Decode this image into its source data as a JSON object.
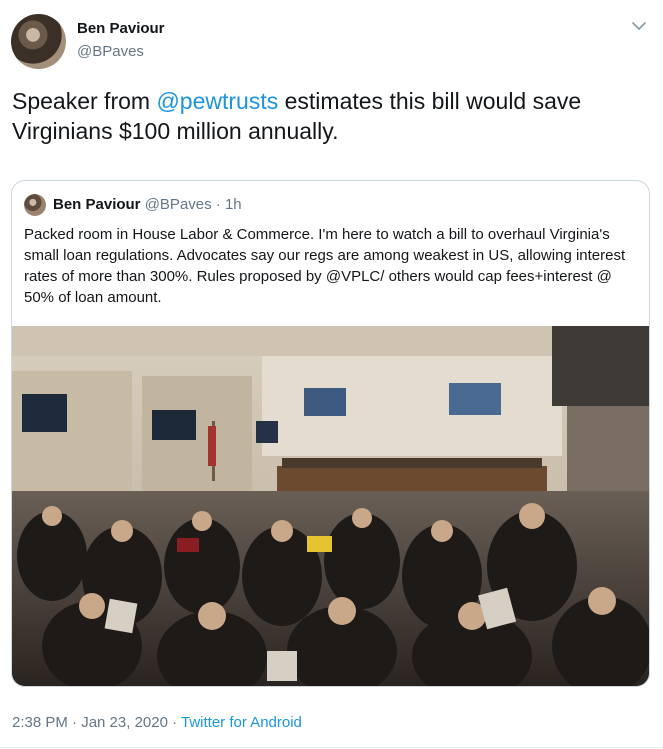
{
  "author": {
    "name": "Ben Paviour",
    "handle": "@BPaves"
  },
  "tweet": {
    "text_before": "Speaker from ",
    "mention": "@pewtrusts",
    "text_after": " estimates this bill would save Virginians $100 million annually."
  },
  "quoted_tweet": {
    "name": "Ben Paviour",
    "handle": "@BPaves",
    "separator": " · ",
    "time": "1h",
    "text": "Packed room in House Labor & Commerce. I'm here to watch a bill to overhaul Virginia's small loan regulations. Advocates say our regs are among weakest in US, allowing interest rates of more than 300%. Rules proposed by @VPLC/ others would cap fees+interest @ 50% of loan amount."
  },
  "footer": {
    "timestamp": "2:38 PM · Jan 23, 2020",
    "separator": " · ",
    "source": "Twitter for Android"
  },
  "icons": {
    "caret": "chevron-down-icon"
  },
  "colors": {
    "link": "#1b95e0",
    "secondary_text": "#657786",
    "border": "#ccd6dd"
  }
}
